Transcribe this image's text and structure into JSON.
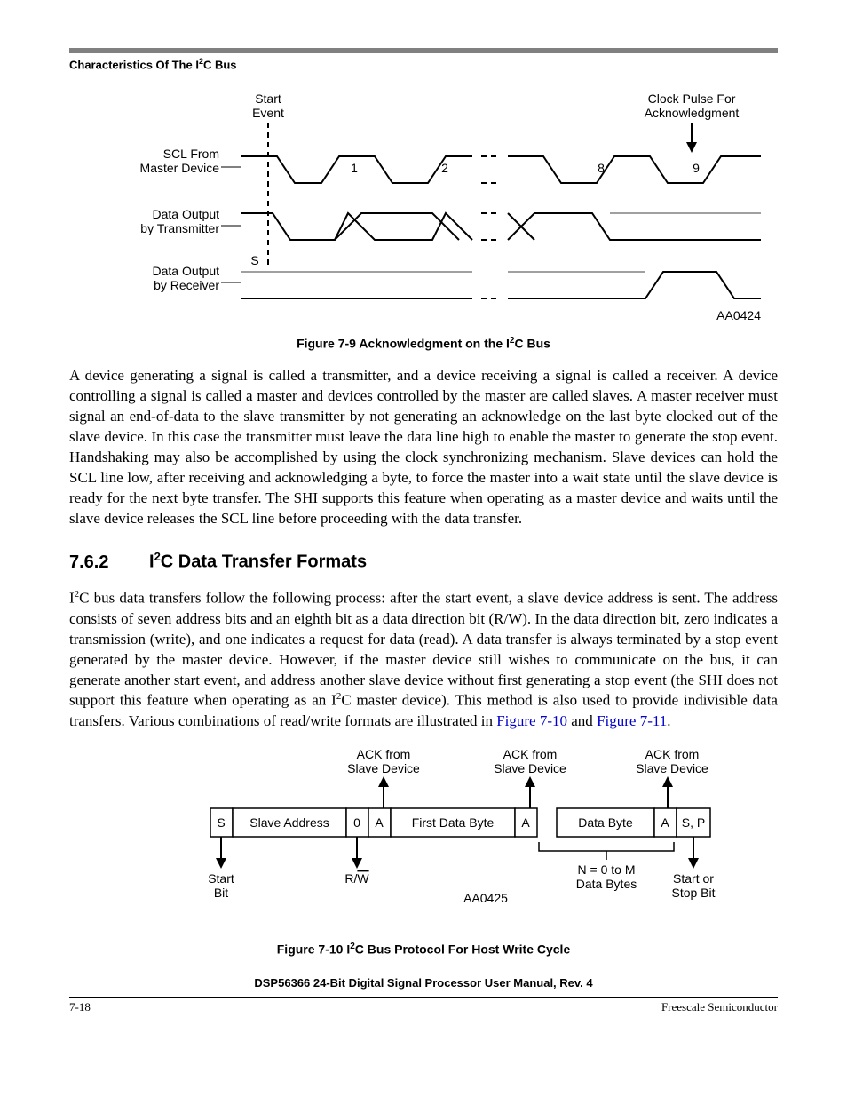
{
  "header": {
    "title_pre": "Characteristics Of The I",
    "title_sup": "2",
    "title_post": "C Bus"
  },
  "fig79": {
    "labels": {
      "start_event": "Start\nEvent",
      "clock_pulse": "Clock Pulse For\nAcknowledgment",
      "scl_from": "SCL From\nMaster Device",
      "data_tx": "Data Output\nby Transmitter",
      "data_rx": "Data Output\nby Receiver",
      "s_label": "S",
      "nums": [
        "1",
        "2",
        "8",
        "9"
      ],
      "code": "AA0424"
    },
    "caption_pre": "Figure 7-9  Acknowledgment on the I",
    "caption_sup": "2",
    "caption_post": "C Bus"
  },
  "para1_parts": {
    "full": "A device generating a signal is called a transmitter, and a device receiving a signal is called a receiver. A device controlling a signal is called a master and devices controlled by the master are called slaves. A master receiver must signal an end-of-data to the slave transmitter by not generating an acknowledge on the last byte clocked out of the slave device. In this case the transmitter must leave the data line high to enable the master to generate the stop event. Handshaking may also be accomplished by using the clock synchronizing mechanism. Slave devices can hold the SCL line low, after receiving and acknowledging a byte, to force the master into a wait state until the slave device is ready for the next byte transfer. The SHI supports this feature when operating as a master device and waits until the slave device releases the SCL line before proceeding with the data transfer."
  },
  "section": {
    "num": "7.6.2",
    "title_pre": "I",
    "title_sup": "2",
    "title_post": "C Data Transfer Formats"
  },
  "para2": {
    "p1": "I",
    "p1sup": "2",
    "p2": "C bus data transfers follow the following process: after the start event, a slave device address is sent. The address consists of seven address bits and an eighth bit as a data direction bit (R/W). In the data direction bit, zero indicates a transmission (write), and one indicates a request for data (read). A data transfer is always terminated by a stop event generated by the master device. However, if the master device still wishes to communicate on the bus, it can generate another start event, and address another slave device without first generating a stop event (the SHI does not support this feature when operating as an I",
    "p2sup": "2",
    "p3": "C master device). This method is also used to provide indivisible data transfers. Various combinations of read/write formats are illustrated in ",
    "link1": "Figure 7-10",
    "and": " and ",
    "link2": "Figure 7-11",
    "end": "."
  },
  "fig710": {
    "labels": {
      "ack1": "ACK from\nSlave Device",
      "ack2": "ACK from\nSlave Device",
      "ack3": "ACK from\nSlave Device",
      "s": "S",
      "slave_addr": "Slave Address",
      "zero": "0",
      "a": "A",
      "first_byte": "First Data Byte",
      "data_byte": "Data Byte",
      "sp": "S, P",
      "start_bit": "Start\nBit",
      "rw_r": "R/",
      "rw_w": "W",
      "ndata": "N = 0 to M\nData Bytes",
      "stop_bit": "Start or\nStop Bit",
      "code": "AA0425"
    },
    "caption_pre": "Figure 7-10  I",
    "caption_sup": "2",
    "caption_post": "C Bus Protocol For Host Write Cycle"
  },
  "footer": {
    "doc_title": "DSP56366 24-Bit Digital Signal Processor User Manual, Rev. 4",
    "page_num": "7-18",
    "vendor": "Freescale Semiconductor"
  }
}
